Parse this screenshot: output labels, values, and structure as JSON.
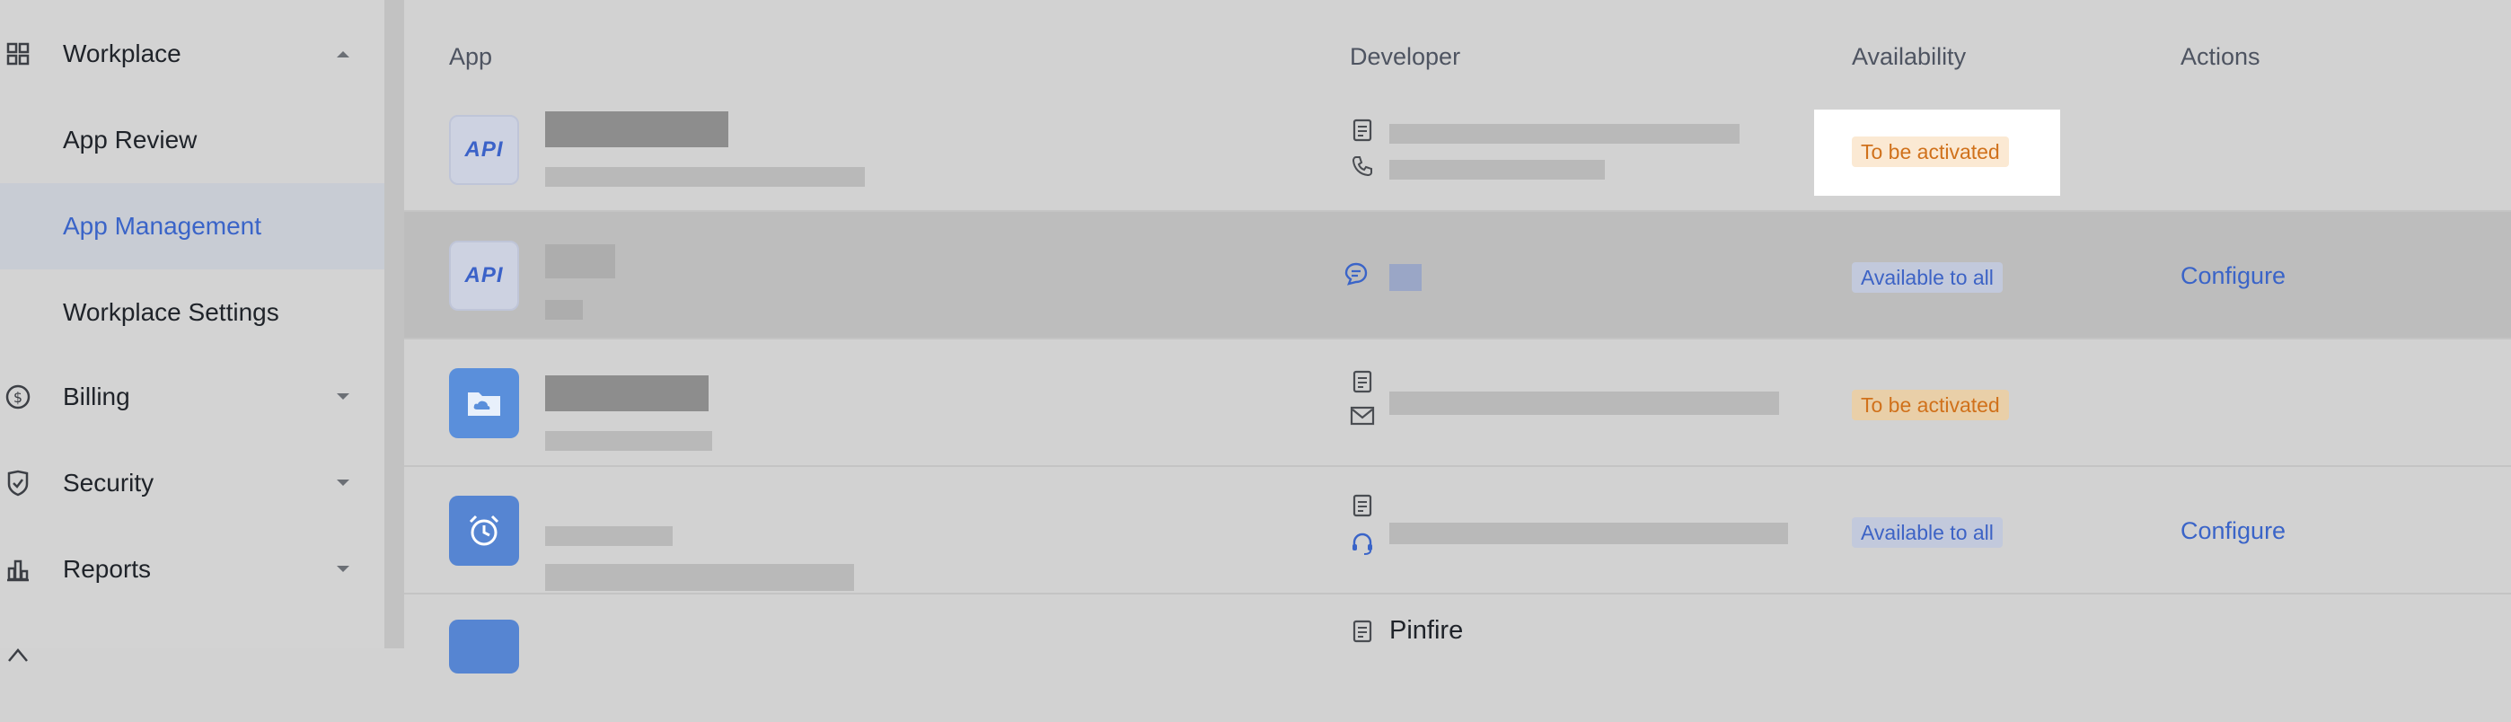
{
  "sidebar": {
    "items": [
      {
        "label": "Workplace",
        "icon": "grid-icon",
        "expanded": true
      },
      {
        "label": "App Review"
      },
      {
        "label": "App Management",
        "active": true
      },
      {
        "label": "Workplace Settings"
      },
      {
        "label": "Billing",
        "icon": "dollar-circle-icon"
      },
      {
        "label": "Security",
        "icon": "shield-icon"
      },
      {
        "label": "Reports",
        "icon": "bar-chart-icon"
      }
    ]
  },
  "table": {
    "columns": [
      "App",
      "Developer",
      "Availability",
      "Actions"
    ],
    "rows": [
      {
        "icon": "API",
        "availability": "To be activated",
        "action": ""
      },
      {
        "icon": "API",
        "availability": "Available to all",
        "action": "Configure"
      },
      {
        "icon": "cloud-folder-icon",
        "availability": "To be activated",
        "action": ""
      },
      {
        "icon": "alarm-clock-icon",
        "availability": "Available to all",
        "action": "Configure"
      },
      {
        "icon": "app-icon",
        "developer": "Pinfire",
        "availability": "",
        "action": ""
      }
    ]
  },
  "colors": {
    "accent": "#3a64c8",
    "warning": "#d0711b"
  }
}
